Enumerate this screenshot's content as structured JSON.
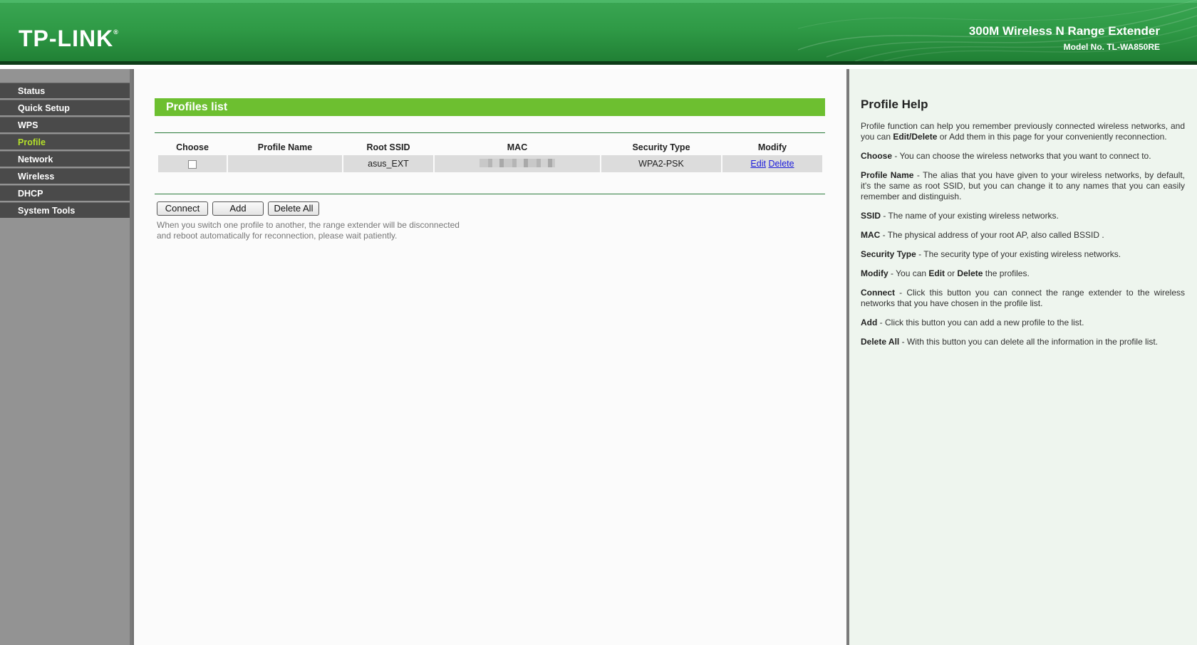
{
  "header": {
    "logo": "TP-LINK",
    "logo_mark": "®",
    "product_title": "300M Wireless N Range Extender",
    "model_no": "Model No. TL-WA850RE"
  },
  "sidebar": {
    "items": [
      {
        "label": "Status",
        "active": false
      },
      {
        "label": "Quick Setup",
        "active": false
      },
      {
        "label": "WPS",
        "active": false
      },
      {
        "label": "Profile",
        "active": true
      },
      {
        "label": "Network",
        "active": false
      },
      {
        "label": "Wireless",
        "active": false
      },
      {
        "label": "DHCP",
        "active": false
      },
      {
        "label": "System Tools",
        "active": false
      }
    ]
  },
  "main": {
    "section_title": "Profiles list",
    "table": {
      "headers": [
        "Choose",
        "Profile Name",
        "Root SSID",
        "MAC",
        "Security Type",
        "Modify"
      ],
      "rows": [
        {
          "profile_name": "",
          "root_ssid": "asus_EXT",
          "mac": "",
          "security_type": "WPA2-PSK",
          "edit": "Edit",
          "delete": "Delete"
        }
      ]
    },
    "buttons": {
      "connect": "Connect",
      "add": "Add",
      "delete_all": "Delete All"
    },
    "note_line1": "When you switch one profile to another, the range extender will be disconnected",
    "note_line2": "and reboot automatically for reconnection, please wait patiently."
  },
  "help": {
    "title": "Profile Help",
    "intro_1": "Profile function can help you remember previously connected wireless networks, and you can ",
    "intro_bold": "Edit/Delete",
    "intro_2": " or Add them in this page for your conveniently reconnection.",
    "choose_term": "Choose",
    "choose_desc": " - You can choose the wireless networks that you want to connect to.",
    "profile_name_term": "Profile Name",
    "profile_name_desc": " - The alias that you have given to your wireless networks, by default, it's the same as root SSID, but you can change it to any names that you can easily remember and distinguish.",
    "ssid_term": "SSID",
    "ssid_desc": " - The name of your existing wireless networks.",
    "mac_term": "MAC",
    "mac_desc": " - The physical address of your root AP, also called BSSID .",
    "security_term": "Security Type",
    "security_desc": " - The security type of your existing wireless networks.",
    "modify_term": "Modify",
    "modify_desc_1": " - You can ",
    "modify_edit": "Edit",
    "modify_desc_2": " or ",
    "modify_delete": "Delete",
    "modify_desc_3": " the profiles.",
    "connect_term": "Connect",
    "connect_desc": " - Click this button you can connect the range extender to the wireless networks that you have chosen in the profile list.",
    "add_term": "Add",
    "add_desc": " - Click this button you can add a new profile to the list.",
    "delete_all_term": "Delete All",
    "delete_all_desc": " - With this button you can delete all the information in the profile list."
  }
}
